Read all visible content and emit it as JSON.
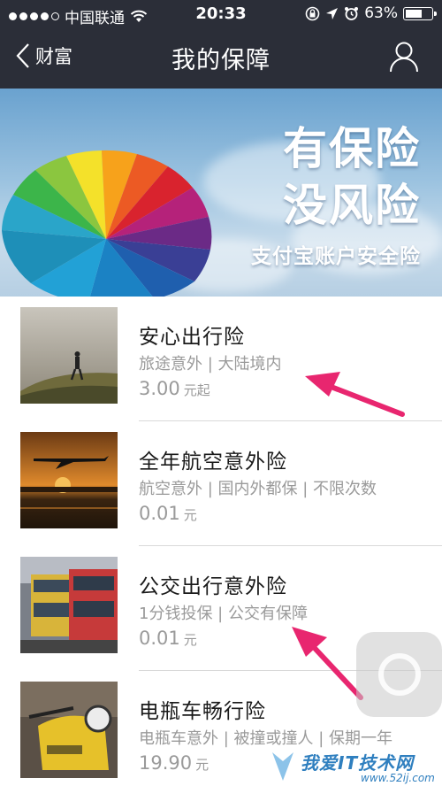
{
  "status_bar": {
    "carrier": "中国联通",
    "time": "20:33",
    "battery_percent": "63%",
    "battery_level": 0.63
  },
  "nav": {
    "back_label": "财富",
    "title": "我的保障"
  },
  "banner": {
    "line1": "有保险",
    "line2": "没风险",
    "line3": "支付宝账户安全险"
  },
  "products": [
    {
      "title": "安心出行险",
      "desc": "旅途意外 | 大陆境内",
      "price": "3.00",
      "unit": "元起"
    },
    {
      "title": "全年航空意外险",
      "desc": "航空意外 | 国内外都保 | 不限次数",
      "price": "0.01",
      "unit": "元"
    },
    {
      "title": "公交出行意外险",
      "desc": "1分钱投保 | 公交有保障",
      "price": "0.01",
      "unit": "元"
    },
    {
      "title": "电瓶车畅行险",
      "desc": "电瓶车意外 | 被撞或撞人 | 保期一年",
      "price": "19.90",
      "unit": "元"
    }
  ],
  "watermark": {
    "text": "我爱IT技术网",
    "sub": "www.52ij.com"
  },
  "colors": {
    "nav_bg": "#2b2e38",
    "arrow": "#e8266f",
    "text_gray": "#9a9a9a"
  }
}
